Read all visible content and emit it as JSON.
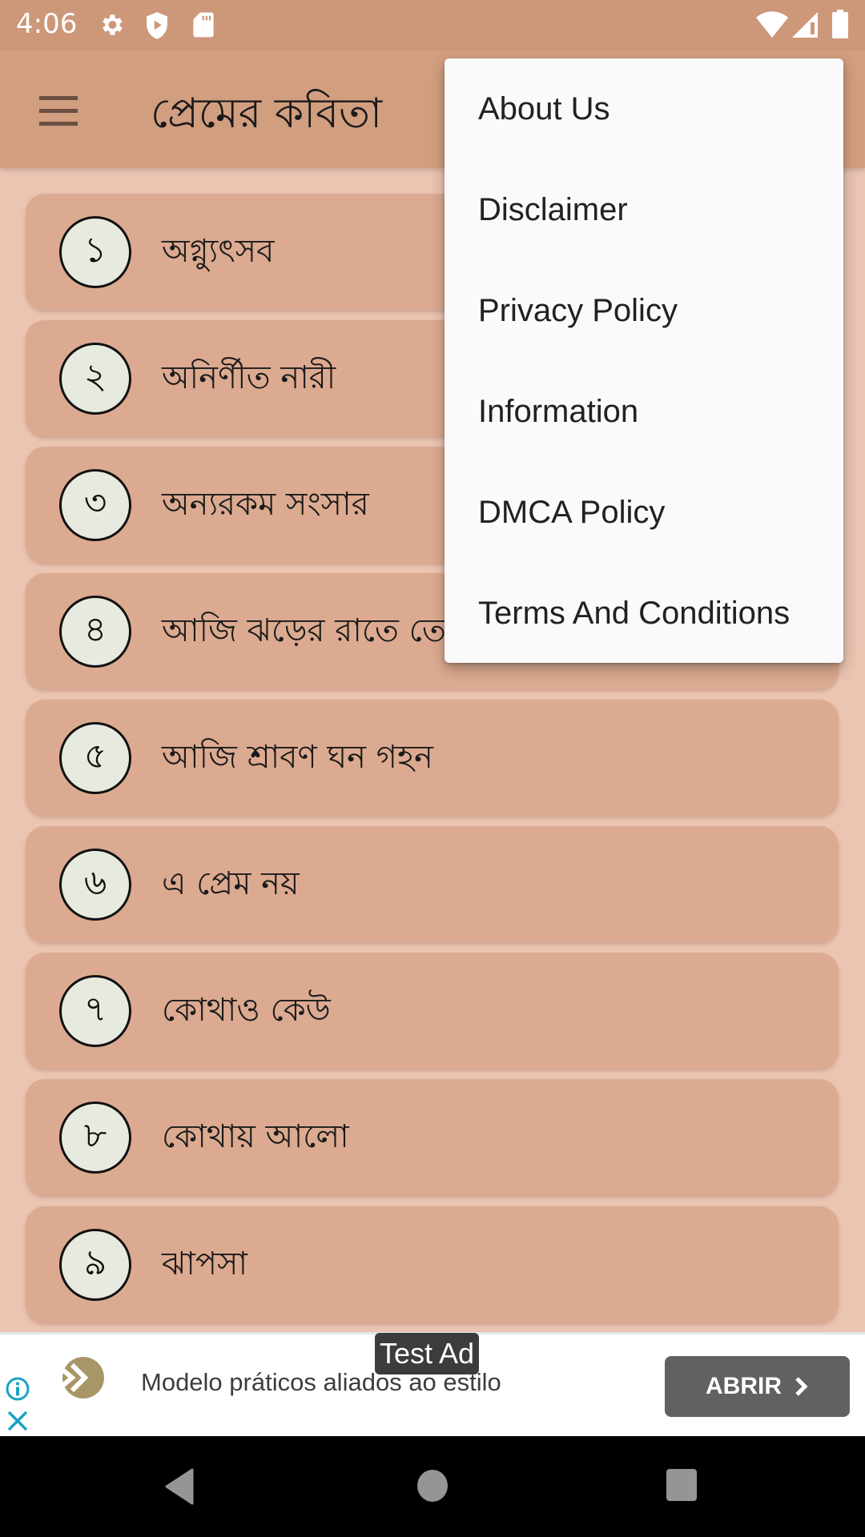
{
  "status_bar": {
    "time": "4:06",
    "left_icons": [
      "settings-icon",
      "play-protect-icon",
      "sd-card-icon"
    ],
    "right_icons": [
      "wifi-icon",
      "cell-signal-icon",
      "battery-icon"
    ]
  },
  "app_bar": {
    "title": "প্রেমের কবিতা",
    "menu_icon": "hamburger-menu-icon"
  },
  "poems": [
    {
      "number": "১",
      "title": "অগ্ন্যুৎসব"
    },
    {
      "number": "২",
      "title": "অনির্ণীত নারী"
    },
    {
      "number": "৩",
      "title": "অন্যরকম সংসার"
    },
    {
      "number": "৪",
      "title": "আজি ঝড়ের রাতে তোমার অভিসার"
    },
    {
      "number": "৫",
      "title": "আজি শ্রাবণ ঘন গহন"
    },
    {
      "number": "৬",
      "title": "এ প্রেম নয়"
    },
    {
      "number": "৭",
      "title": "কোথাও কেউ"
    },
    {
      "number": "৮",
      "title": "কোথায় আলো"
    },
    {
      "number": "৯",
      "title": "ঝাপসা"
    }
  ],
  "overflow_menu": {
    "items": [
      {
        "label": "About Us"
      },
      {
        "label": "Disclaimer"
      },
      {
        "label": "Privacy Policy"
      },
      {
        "label": "Information"
      },
      {
        "label": "DMCA Policy"
      },
      {
        "label": "Terms And Conditions"
      }
    ]
  },
  "ad": {
    "badge": "Test Ad",
    "text": "Modelo práticos aliados ao estilo",
    "cta": "ABRIR",
    "accent_color": "#1aa3c3",
    "logo_color": "#a89766"
  },
  "nav_bar": {
    "buttons": [
      "back-icon",
      "home-icon",
      "recents-icon"
    ]
  },
  "colors": {
    "status_bar": "#cd977a",
    "app_bar": "#d29e80",
    "background": "#ecc4b2",
    "card": "#dcaa90",
    "circle_fill": "#e7ebdf"
  }
}
